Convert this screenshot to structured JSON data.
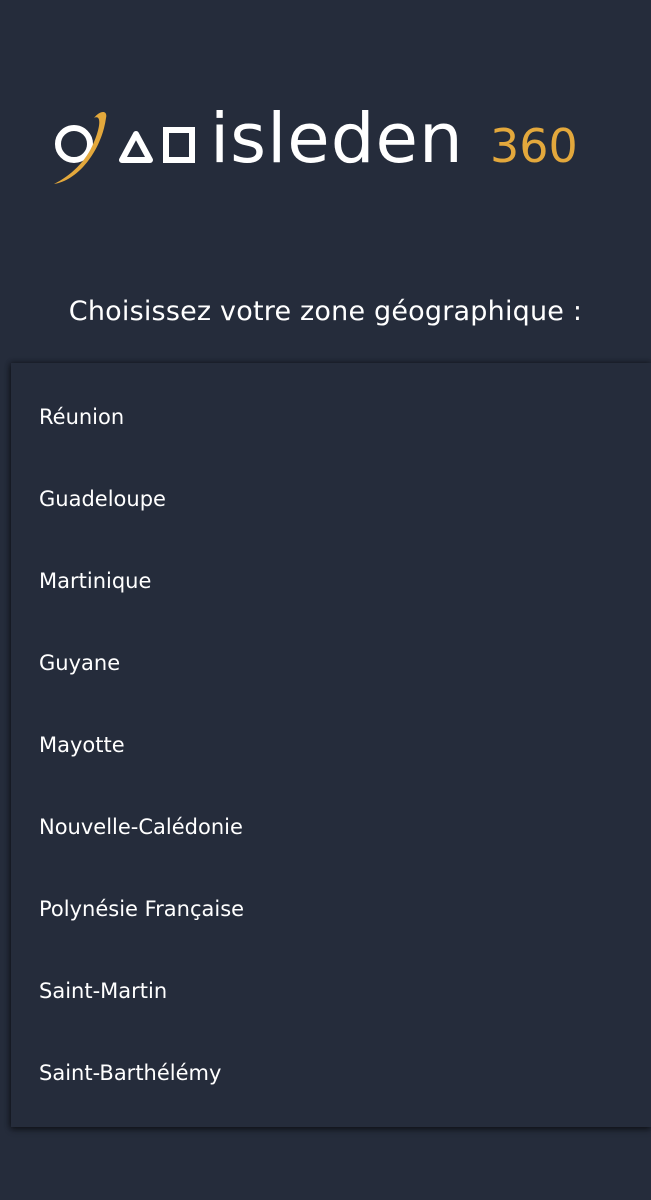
{
  "logo": {
    "brand": "isleden",
    "suffix": "360",
    "accent_color": "#e3a83c",
    "mark_icons": [
      "orbit-circle-icon",
      "triangle-icon",
      "square-icon"
    ]
  },
  "prompt": "Choisissez votre zone géographique :",
  "zones": [
    {
      "label": "Réunion"
    },
    {
      "label": "Guadeloupe"
    },
    {
      "label": "Martinique"
    },
    {
      "label": "Guyane"
    },
    {
      "label": "Mayotte"
    },
    {
      "label": "Nouvelle-Calédonie"
    },
    {
      "label": "Polynésie Française"
    },
    {
      "label": "Saint-Martin"
    },
    {
      "label": "Saint-Barthélémy"
    }
  ],
  "colors": {
    "background": "#252c3b",
    "text": "#ffffff"
  }
}
